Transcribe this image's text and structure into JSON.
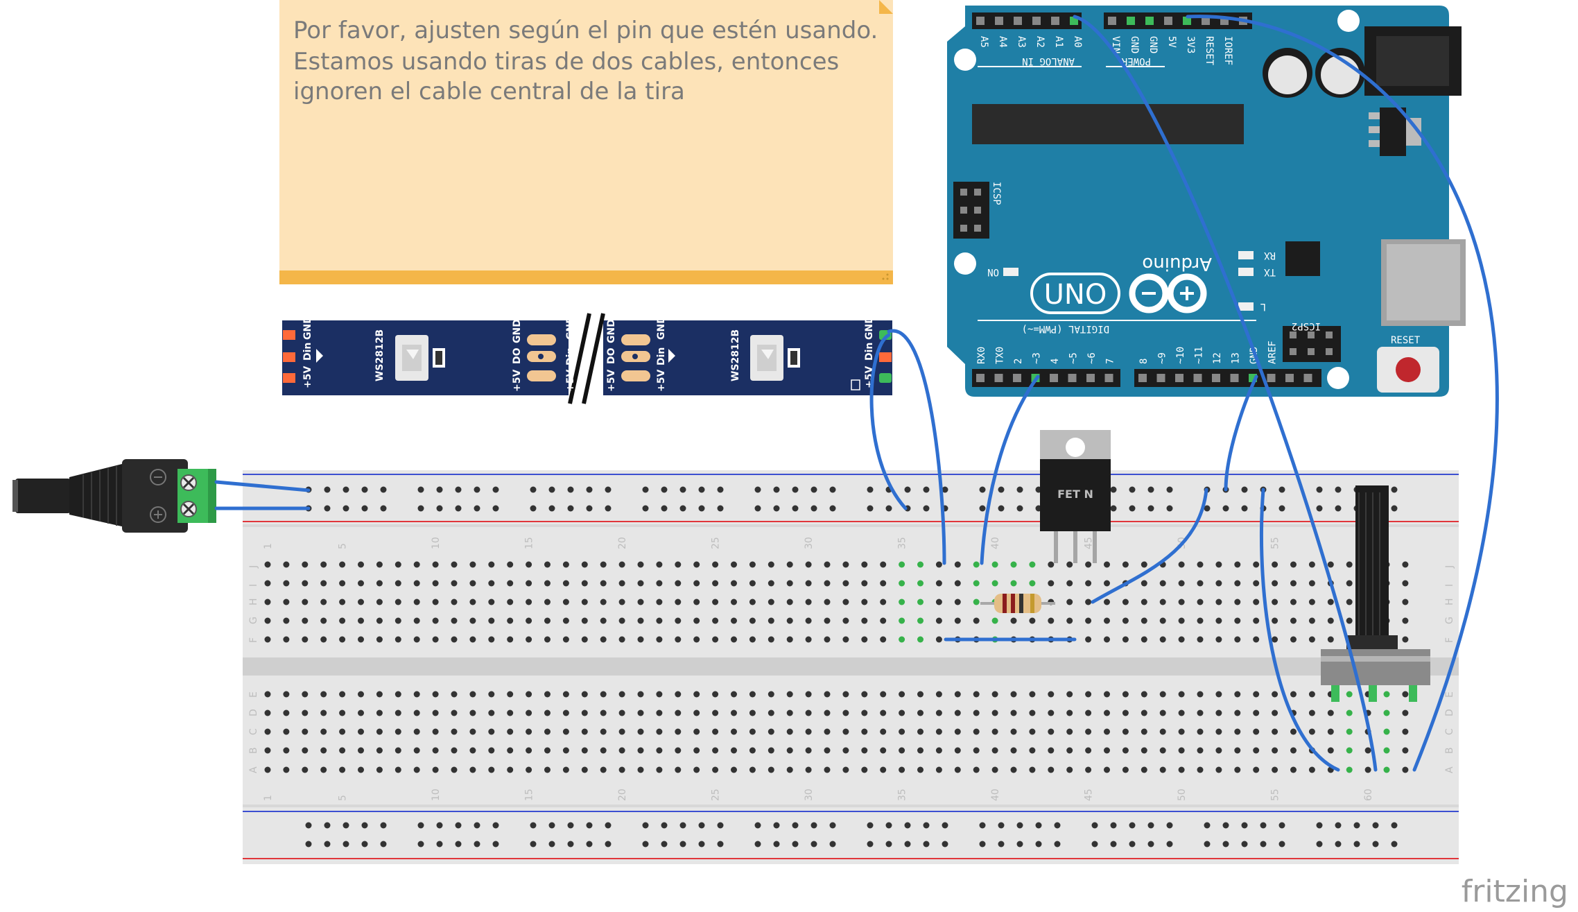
{
  "note": {
    "lines": [
      "Por favor, ajusten según el pin que estén usando.",
      "Estamos usando tiras de dos cables, entonces",
      "ignoren el cable central de la tira"
    ]
  },
  "led_strip": {
    "chip_label": "WS2812B",
    "left_pads": [
      "+5V",
      "Din",
      "GND"
    ],
    "middle_left_pads": [
      "+5V",
      "DO",
      "GND"
    ],
    "middle_right_pads": [
      "+5V",
      "DO",
      "GND"
    ],
    "right_pads": [
      "+5V",
      "Din",
      "GND"
    ]
  },
  "arduino": {
    "brand": "Arduino",
    "model": "UNO",
    "analog_header_label": "ANALOG IN",
    "analog_pins": [
      "A5",
      "A4",
      "A3",
      "A2",
      "A1",
      "A0"
    ],
    "power_header_label": "POWER",
    "power_pins": [
      "VIN",
      "GND",
      "GND",
      "5V",
      "3V3",
      "RESET",
      "IOREF"
    ],
    "digital_header_label": "DIGITAL (PWM=~)",
    "digital_pins_low": [
      "RX0",
      "TX0",
      "2",
      "~3",
      "4",
      "~5",
      "~6",
      "7"
    ],
    "digital_pins_high": [
      "8",
      "~9",
      "~10",
      "~11",
      "12",
      "13",
      "GND",
      "AREF"
    ],
    "icsp_label": "ICSP",
    "icsp2_label": "ICSP2",
    "rx_label": "RX",
    "tx_label": "TX",
    "l_label": "L",
    "on_label": "ON",
    "reset_label": "RESET"
  },
  "mosfet": {
    "label": "FET N"
  },
  "breadboard": {
    "column_numbers": [
      "1",
      "5",
      "10",
      "15",
      "20",
      "25",
      "30",
      "35",
      "40",
      "45",
      "50",
      "55",
      "60"
    ],
    "rows_top": [
      "J",
      "I",
      "H",
      "G",
      "F"
    ],
    "rows_bottom": [
      "E",
      "D",
      "C",
      "B",
      "A"
    ]
  },
  "colors": {
    "wire": "#2f6fd0",
    "arduino": "#1f7fa6",
    "strip": "#1b2f63",
    "note": "#fde3b8",
    "note_bar": "#f4b649",
    "breadboard": "#e6e6e6",
    "rail_red": "#e0363a",
    "rail_blue": "#3c4fd1",
    "terminal": "#3dbb5a",
    "hole_green": "#36b24a"
  },
  "footer": {
    "logo": "fritzing"
  }
}
